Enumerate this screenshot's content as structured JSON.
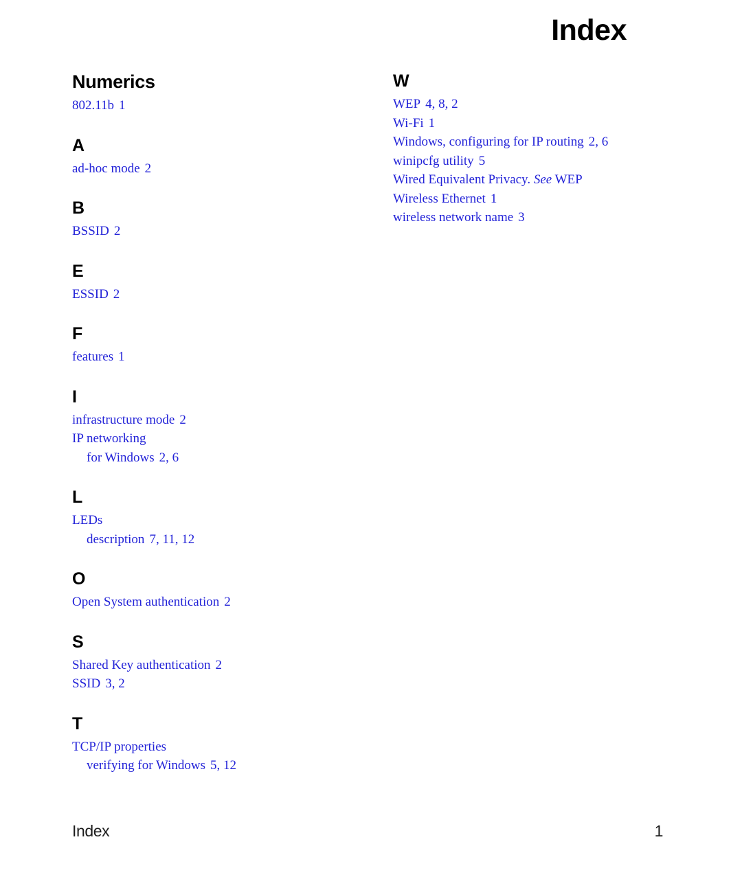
{
  "document": {
    "title": "Index"
  },
  "columns": [
    {
      "id": "left",
      "sections": [
        {
          "heading": "Numerics",
          "heading_style": "word",
          "entries": [
            {
              "term": "802.11b",
              "locators": "1",
              "sub": false
            }
          ]
        },
        {
          "heading": "A",
          "heading_style": "letter",
          "entries": [
            {
              "term": "ad-hoc mode",
              "locators": "2",
              "sub": false
            }
          ]
        },
        {
          "heading": "B",
          "heading_style": "letter",
          "entries": [
            {
              "term": "BSSID",
              "locators": "2",
              "sub": false
            }
          ]
        },
        {
          "heading": "E",
          "heading_style": "letter",
          "entries": [
            {
              "term": "ESSID",
              "locators": "2",
              "sub": false
            }
          ]
        },
        {
          "heading": "F",
          "heading_style": "letter",
          "entries": [
            {
              "term": "features",
              "locators": "1",
              "sub": false
            }
          ]
        },
        {
          "heading": "I",
          "heading_style": "letter",
          "entries": [
            {
              "term": "infrastructure mode",
              "locators": "2",
              "sub": false
            },
            {
              "term": "IP networking",
              "locators": "",
              "sub": false
            },
            {
              "term": "for Windows",
              "locators": "2, 6",
              "sub": true
            }
          ]
        },
        {
          "heading": "L",
          "heading_style": "letter",
          "entries": [
            {
              "term": "LEDs",
              "locators": "",
              "sub": false
            },
            {
              "term": "description",
              "locators": "7, 11, 12",
              "sub": true
            }
          ]
        },
        {
          "heading": "O",
          "heading_style": "letter",
          "entries": [
            {
              "term": "Open System authentication",
              "locators": "2",
              "sub": false
            }
          ]
        },
        {
          "heading": "S",
          "heading_style": "letter",
          "entries": [
            {
              "term": "Shared Key authentication",
              "locators": "2",
              "sub": false
            },
            {
              "term": "SSID",
              "locators": "3, 2",
              "sub": false
            }
          ]
        },
        {
          "heading": "T",
          "heading_style": "letter",
          "entries": [
            {
              "term": "TCP/IP properties",
              "locators": "",
              "sub": false
            },
            {
              "term": "verifying for Windows",
              "locators": "5, 12",
              "sub": true
            }
          ]
        }
      ]
    },
    {
      "id": "right",
      "sections": [
        {
          "heading": "W",
          "heading_style": "letter",
          "entries": [
            {
              "term": "WEP",
              "locators": "4, 8, 2",
              "sub": false
            },
            {
              "term": "Wi-Fi",
              "locators": "1",
              "sub": false
            },
            {
              "term": "Windows, configuring for IP routing",
              "locators": "2, 6",
              "sub": false
            },
            {
              "term": "winipcfg utility",
              "locators": "5",
              "sub": false
            },
            {
              "term": "Wired Equivalent Privacy.",
              "see": "See",
              "see_target": "WEP",
              "locators": "",
              "sub": false
            },
            {
              "term": "Wireless Ethernet",
              "locators": "1",
              "sub": false
            },
            {
              "term": "wireless network name",
              "locators": "3",
              "sub": false
            }
          ]
        }
      ]
    }
  ],
  "footer": {
    "label": "Index",
    "page_number": "1"
  },
  "colors": {
    "entry_blue": "#2323d8",
    "heading_black": "#000000",
    "page_background": "#ffffff"
  }
}
